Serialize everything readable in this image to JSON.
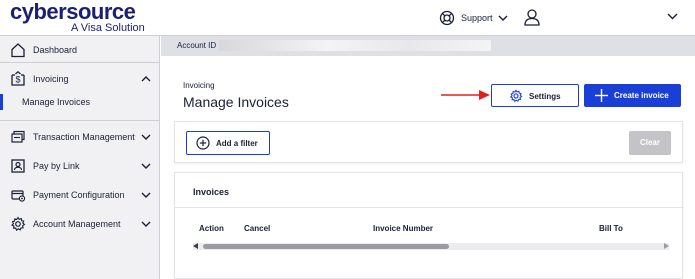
{
  "brand": {
    "name": "cybersource",
    "tagline": "A Visa Solution",
    "color": "#1a1f71"
  },
  "header": {
    "support_label": "Support"
  },
  "sidebar": {
    "items": [
      {
        "label": "Dashboard",
        "icon": "home-icon"
      },
      {
        "label": "Invoicing",
        "icon": "invoice-icon",
        "expanded": true
      },
      {
        "label": "Manage Invoices",
        "active": true
      },
      {
        "label": "Transaction Management",
        "icon": "transactions-icon"
      },
      {
        "label": "Pay by Link",
        "icon": "pay-by-link-icon"
      },
      {
        "label": "Payment Configuration",
        "icon": "payment-config-icon"
      },
      {
        "label": "Account Management",
        "icon": "gear-icon"
      }
    ]
  },
  "account": {
    "label": "Account ID"
  },
  "page": {
    "breadcrumb": "Invoicing",
    "title": "Manage Invoices"
  },
  "actions": {
    "settings_label": "Settings",
    "create_label": "Create invoice",
    "accent": "#1a3fd6"
  },
  "filter": {
    "add_label": "Add a filter",
    "clear_label": "Clear"
  },
  "invoices": {
    "title": "Invoices",
    "columns": [
      "Action",
      "Cancel",
      "Invoice Number",
      "Bill To"
    ]
  },
  "annotation": {
    "arrow_color": "#e02020"
  }
}
